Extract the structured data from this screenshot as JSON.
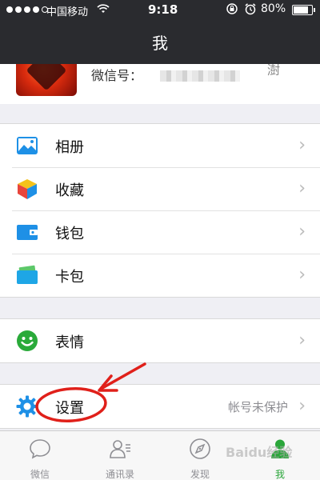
{
  "status_bar": {
    "carrier": "中国移动",
    "time": "9:18",
    "battery_text": "80%",
    "battery_level": 0.8,
    "signal_bars": 4
  },
  "header": {
    "title": "我"
  },
  "profile": {
    "wechat_id_label": "微信号：",
    "qr_hint": "澍"
  },
  "menu_groups": [
    {
      "items": [
        {
          "label": "相册",
          "icon": "photo-album-icon",
          "color": "#1e90e6"
        },
        {
          "label": "收藏",
          "icon": "favorites-cube-icon",
          "color": "#f5a623"
        },
        {
          "label": "钱包",
          "icon": "wallet-icon",
          "color": "#1e90e6"
        },
        {
          "label": "卡包",
          "icon": "card-pack-icon",
          "color": "#1ea6e6"
        }
      ]
    },
    {
      "items": [
        {
          "label": "表情",
          "icon": "emoji-icon",
          "color": "#2aaa3a"
        }
      ]
    },
    {
      "items": [
        {
          "label": "设置",
          "icon": "gear-icon",
          "color": "#1e90e6",
          "note": "帐号未保护"
        }
      ]
    }
  ],
  "tab_bar": {
    "tabs": [
      {
        "label": "微信",
        "icon": "chat-icon"
      },
      {
        "label": "通讯录",
        "icon": "contacts-icon"
      },
      {
        "label": "发现",
        "icon": "compass-icon"
      },
      {
        "label": "我",
        "icon": "me-icon",
        "active": true
      }
    ]
  },
  "watermark": "Baidu经验",
  "colors": {
    "header_bg": "#2a2b2f",
    "accent_green": "#2aa63a",
    "annotation_red": "#e0201a"
  }
}
